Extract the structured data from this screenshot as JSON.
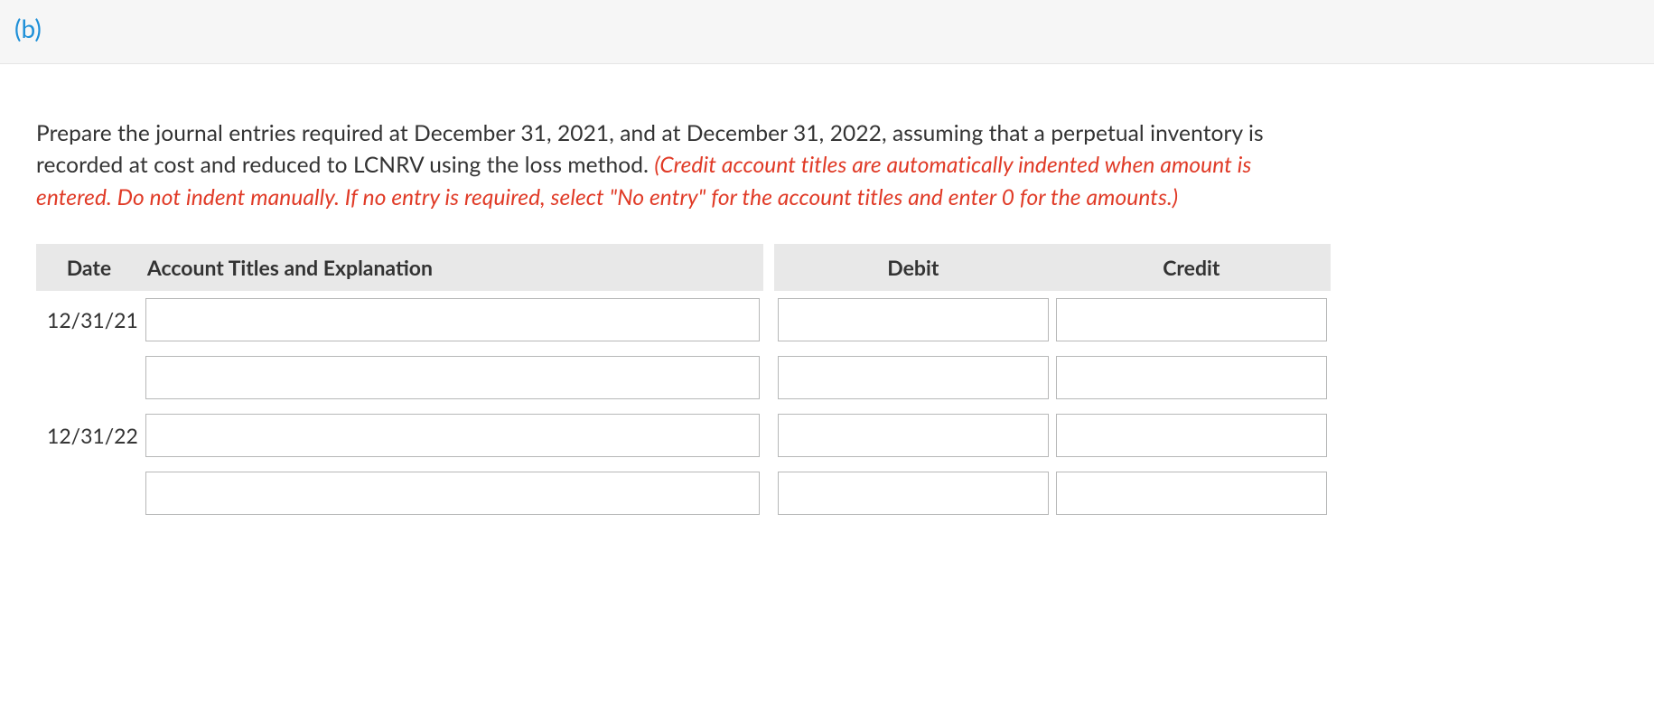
{
  "part_label": "(b)",
  "instructions": {
    "main": "Prepare the journal entries required at December 31, 2021, and at December 31, 2022, assuming that a perpetual inventory is recorded at cost and reduced to LCNRV using the loss method. ",
    "note": "(Credit account titles are automatically indented when amount is entered. Do not indent manually. If no entry is required, select \"No entry\" for the account titles and enter 0 for the amounts.)"
  },
  "table": {
    "headers": {
      "date": "Date",
      "account": "Account Titles and Explanation",
      "debit": "Debit",
      "credit": "Credit"
    },
    "rows": [
      {
        "date": "12/31/21",
        "account": "",
        "debit": "",
        "credit": ""
      },
      {
        "date": "",
        "account": "",
        "debit": "",
        "credit": ""
      },
      {
        "date": "12/31/22",
        "account": "",
        "debit": "",
        "credit": ""
      },
      {
        "date": "",
        "account": "",
        "debit": "",
        "credit": ""
      }
    ]
  }
}
